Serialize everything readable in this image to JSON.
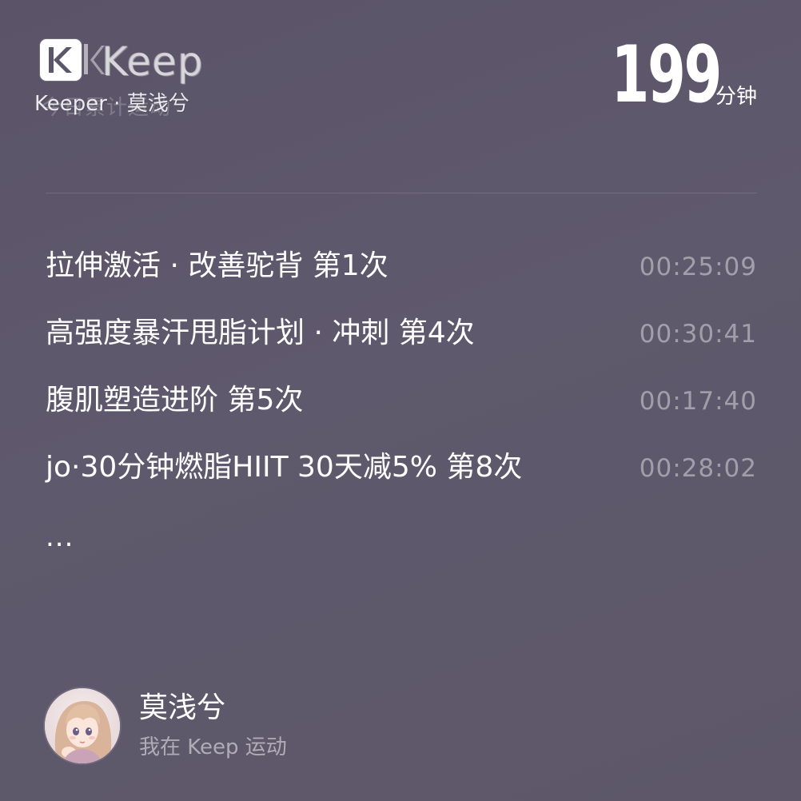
{
  "header": {
    "logo_text": "Keep",
    "ghost_label": "今日累计运动",
    "keeper_line": "Keeper · 莫浅兮",
    "total_value": "199",
    "total_unit": "分钟"
  },
  "workouts": [
    {
      "title": "拉伸激活 · 改善驼背 第1次",
      "time": "00:25:09"
    },
    {
      "title": "高强度暴汗甩脂计划 · 冲刺 第4次",
      "time": "00:30:41"
    },
    {
      "title": "腹肌塑造进阶 第5次",
      "time": "00:17:40"
    },
    {
      "title": "jo·30分钟燃脂HIIT 30天减5% 第8次",
      "time": "00:28:02"
    }
  ],
  "more_indicator": "...",
  "user": {
    "name": "莫浅兮",
    "subtitle": "我在 Keep 运动"
  },
  "colors": {
    "background": "#5c566b",
    "text_primary": "#ffffff",
    "text_secondary": "rgba(255,255,255,0.42)"
  },
  "icons": {
    "logo": "keep-logo-icon",
    "avatar": "user-avatar-illustration"
  }
}
